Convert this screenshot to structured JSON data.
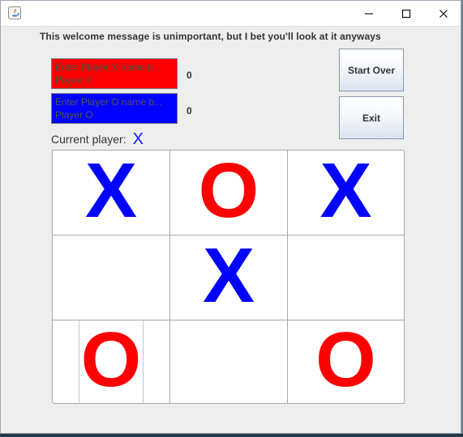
{
  "window": {
    "title": "",
    "icon": "java-app-icon",
    "controls": {
      "minimize_icon": "minimize-icon",
      "maximize_icon": "maximize-icon",
      "close_icon": "close-icon"
    }
  },
  "header": {
    "welcome_message": "This welcome message is unimportant, but I bet you'll look at it anyways"
  },
  "players": {
    "x": {
      "placeholder": "Enter Player X name b...",
      "value": "Player X",
      "score": "0",
      "background_color": "#ff0000"
    },
    "o": {
      "placeholder": "Enter Player O name b...",
      "value": "Player O",
      "score": "0",
      "background_color": "#0000ff"
    }
  },
  "buttons": {
    "start_over": "Start Over",
    "exit": "Exit"
  },
  "status": {
    "current_player_label": "Current player:",
    "current_player_value": "X"
  },
  "board": {
    "cells": [
      {
        "mark": "X",
        "color": "#0000ff"
      },
      {
        "mark": "O",
        "color": "#ff0000"
      },
      {
        "mark": "X",
        "color": "#0000ff"
      },
      {
        "mark": "",
        "color": ""
      },
      {
        "mark": "X",
        "color": "#0000ff"
      },
      {
        "mark": "",
        "color": ""
      },
      {
        "mark": "O",
        "color": "#ff0000"
      },
      {
        "mark": "",
        "color": ""
      },
      {
        "mark": "O",
        "color": "#ff0000"
      }
    ]
  }
}
